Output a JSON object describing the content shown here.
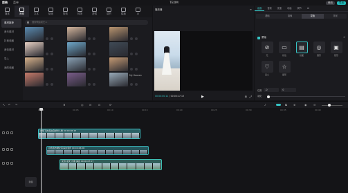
{
  "titlebar": {
    "logo": "剪映",
    "menu": "菜单",
    "title": "TEXIM",
    "pill1": "修改",
    "pill2": "导出"
  },
  "toolbar": {
    "tools": [
      {
        "label": "媒体",
        "icon": "media-icon"
      },
      {
        "label": "音频",
        "icon": "audio-icon"
      },
      {
        "label": "文本",
        "icon": "text-icon"
      },
      {
        "label": "贴纸",
        "icon": "sticker-icon"
      },
      {
        "label": "特效",
        "icon": "effects-icon"
      },
      {
        "label": "转场",
        "icon": "transition-icon"
      },
      {
        "label": "滤镜",
        "icon": "filter-icon"
      },
      {
        "label": "调节",
        "icon": "adjust-icon"
      },
      {
        "label": "模板",
        "icon": "template-icon"
      },
      {
        "label": "AI",
        "icon": "ai-icon"
      }
    ],
    "active_index": 1
  },
  "leftnav": {
    "items": [
      "素材推荐",
      "音乐素材",
      "抖音收藏",
      "音效素材",
      "导入",
      "我的收藏"
    ],
    "active_index": 0
  },
  "media": {
    "search_placeholder": "搜索歌曲或艺人",
    "cards": [
      {
        "label": "",
        "color": "#5a8bb0"
      },
      {
        "label": "",
        "color": "#d2b49c"
      },
      {
        "label": "",
        "color": "#b8946f"
      },
      {
        "label": "",
        "color": "#e8d1c4"
      },
      {
        "label": "",
        "color": "#6ea7c9"
      },
      {
        "label": "",
        "color": "#3f4a56"
      },
      {
        "label": "",
        "color": "#d7b28c"
      },
      {
        "label": "",
        "color": "#8aa2b5"
      },
      {
        "label": "",
        "color": "#c49a74"
      },
      {
        "label": "",
        "color": "#c67b6a"
      },
      {
        "label": "",
        "color": "#7a5c8a"
      },
      {
        "label": "My Heaven",
        "color": "#99aab8"
      }
    ]
  },
  "player": {
    "header": "播放器",
    "timecode_current": "00:00:00:11",
    "timecode_total": "00:00:17:13",
    "play_icon": "play-icon"
  },
  "props": {
    "tabs": [
      "画面",
      "音频",
      "变速",
      "动画",
      "调节",
      "AI"
    ],
    "active_tab": 0,
    "subtabs": [
      "基础",
      "抠像",
      "蒙版",
      "背景"
    ],
    "active_subtab": 2,
    "section_title": "蒙版",
    "masks": [
      {
        "label": "无",
        "icon": "none-icon"
      },
      {
        "label": "线性",
        "icon": "linear-mask-icon"
      },
      {
        "label": "镜面",
        "icon": "mirror-mask-icon"
      },
      {
        "label": "圆形",
        "icon": "circle-mask-icon"
      },
      {
        "label": "矩形",
        "icon": "rect-mask-icon"
      },
      {
        "label": "爱心",
        "icon": "heart-mask-icon"
      },
      {
        "label": "星形",
        "icon": "star-mask-icon"
      }
    ],
    "active_mask_index": 2,
    "position_label": "位置",
    "position_x": "-0",
    "position_y": "0",
    "rotate_label": "旋转",
    "rotate_value": "0°",
    "feather_label": "羽化",
    "feather_value": "0"
  },
  "timeline": {
    "ruler": [
      "00:00",
      "00:05",
      "00:10",
      "00:15",
      "00:20",
      "00:25",
      "00:30",
      "00:35",
      "00:40"
    ],
    "clips": [
      {
        "title": "夕阳下的海边自然光人像   00:00:06:15"
      },
      {
        "title": "白色连衣裙女孩海边漫步   00:00:06:06"
      },
      {
        "title": "女孩 蓝天 沙滩 海边   00:00:07:17"
      }
    ],
    "cover_label": "封面"
  }
}
